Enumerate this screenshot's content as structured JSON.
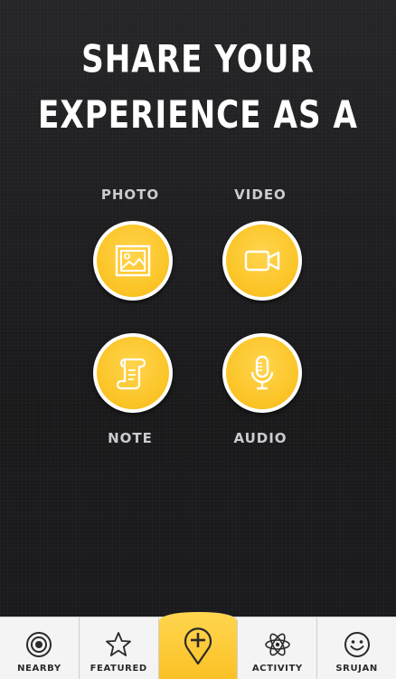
{
  "headline": {
    "line1": "SHARE YOUR",
    "line2": "EXPERIENCE AS A"
  },
  "options": {
    "photo": {
      "label": "PHOTO",
      "icon": "photo-icon"
    },
    "video": {
      "label": "VIDEO",
      "icon": "video-camera-icon"
    },
    "note": {
      "label": "NOTE",
      "icon": "scroll-note-icon"
    },
    "audio": {
      "label": "AUDIO",
      "icon": "microphone-icon"
    }
  },
  "tabbar": {
    "items": [
      {
        "label": "NEARBY",
        "icon": "target-icon"
      },
      {
        "label": "FEATURED",
        "icon": "star-icon"
      },
      {
        "label": "",
        "icon": "add-pin-icon"
      },
      {
        "label": "ACTIVITY",
        "icon": "atom-icon"
      },
      {
        "label": "SRUJAN",
        "icon": "smiley-icon"
      }
    ]
  },
  "colors": {
    "accent": "#fcc62a",
    "background": "#1c1c1f",
    "tabbar": "#f4f4f4"
  }
}
